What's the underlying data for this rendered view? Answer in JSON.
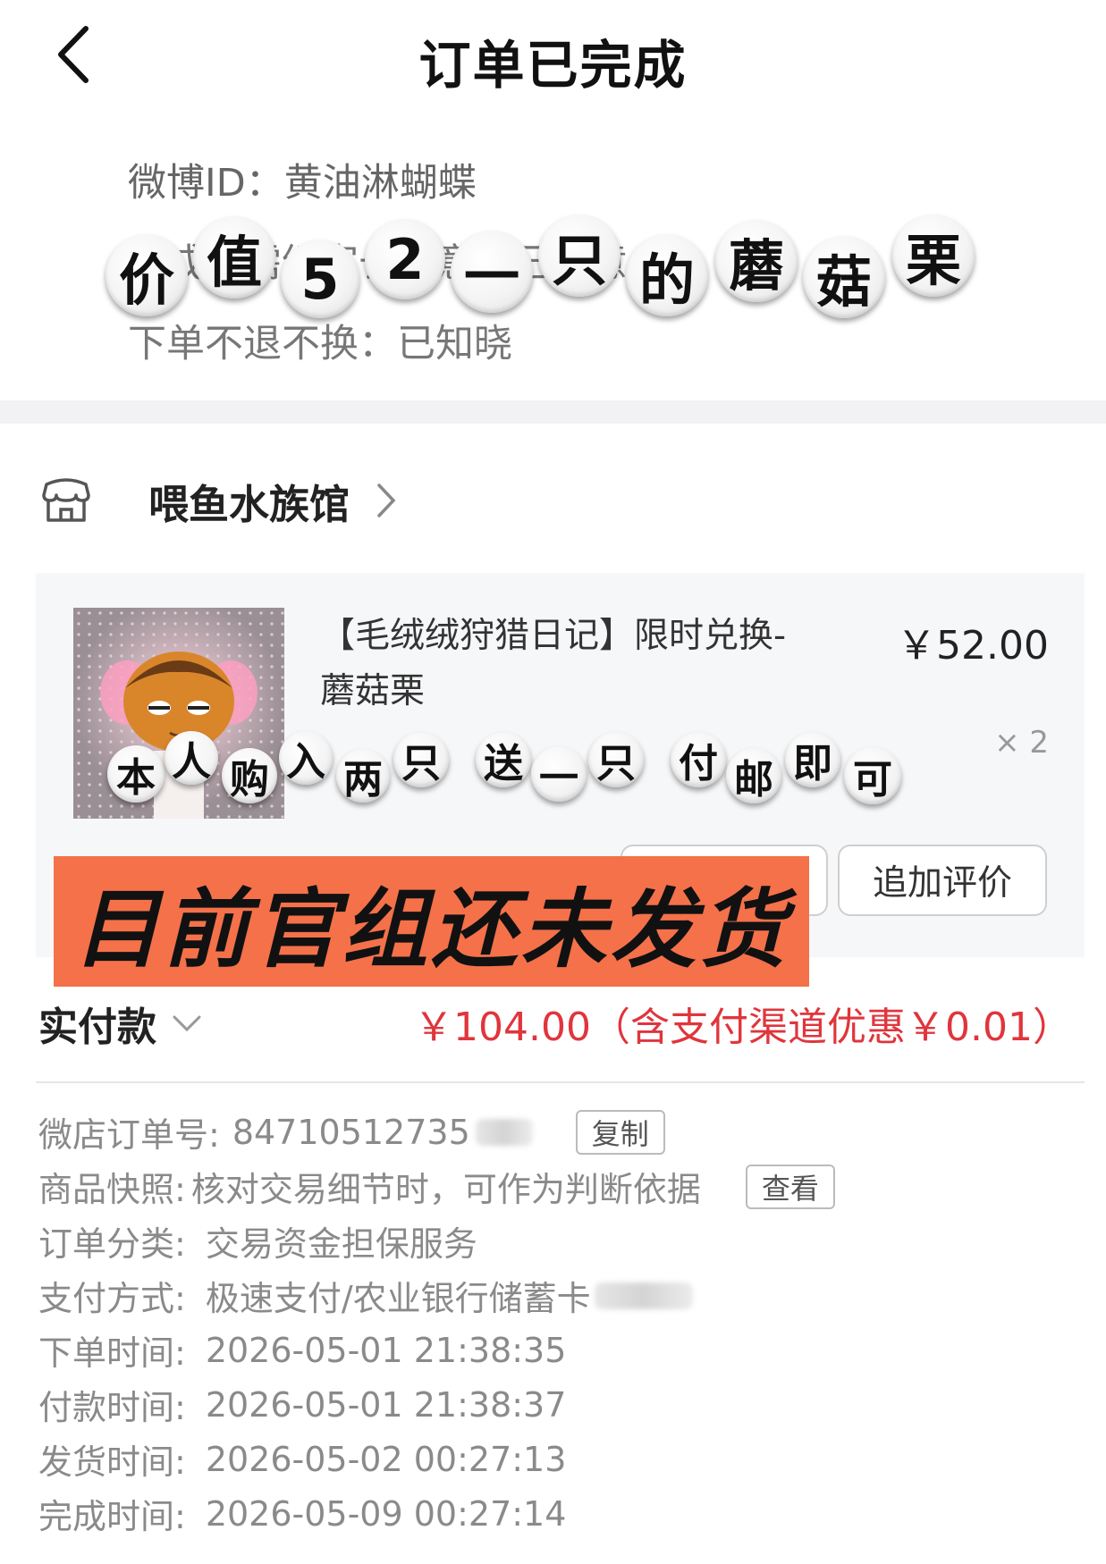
{
  "nav": {
    "title": "订单已完成"
  },
  "info": {
    "weibo": "微博ID：黄油淋蝴蝶",
    "line2": "未成年需经家长同意：已同意",
    "line3": "下单不退不换：已知晓"
  },
  "sticker_top": [
    "价",
    "值",
    "5",
    "2",
    "一",
    "只",
    "的",
    "蘑",
    "菇",
    "栗"
  ],
  "store": {
    "name": "喂鱼水族馆"
  },
  "item": {
    "title": "【毛绒绒狩猎日记】限时兑换-蘑菇栗",
    "price": "￥52.00",
    "qty": "× 2",
    "buttons": {
      "review": "追加评价"
    }
  },
  "sticker_mid": [
    "本",
    "人",
    "购",
    "入",
    "两",
    "只",
    "送",
    "一",
    "只",
    "付",
    "邮",
    "即",
    "可"
  ],
  "banner": "目前官组还未发货",
  "paid": {
    "label": "实付款",
    "amount": "￥104.00（含支付渠道优惠￥0.01）"
  },
  "details": {
    "order_no_key": "微店订单号:",
    "order_no_val": "84710512735",
    "copy": "复制",
    "snapshot_key": "商品快照:",
    "snapshot_val": "核对交易细节时，可作为判断依据",
    "view": "查看",
    "category_key": "订单分类:",
    "category_val": "交易资金担保服务",
    "pay_key": "支付方式:",
    "pay_val": "极速支付/农业银行储蓄卡",
    "order_time_key": "下单时间:",
    "order_time_val": "2026-05-01 21:38:35",
    "paid_time_key": "付款时间:",
    "paid_time_val": "2026-05-01 21:38:37",
    "ship_time_key": "发货时间:",
    "ship_time_val": "2026-05-02 00:27:13",
    "done_time_key": "完成时间:",
    "done_time_val": "2026-05-09 00:27:14"
  },
  "colors": {
    "price_red": "#e0353c",
    "banner_orange": "#f4714a"
  }
}
